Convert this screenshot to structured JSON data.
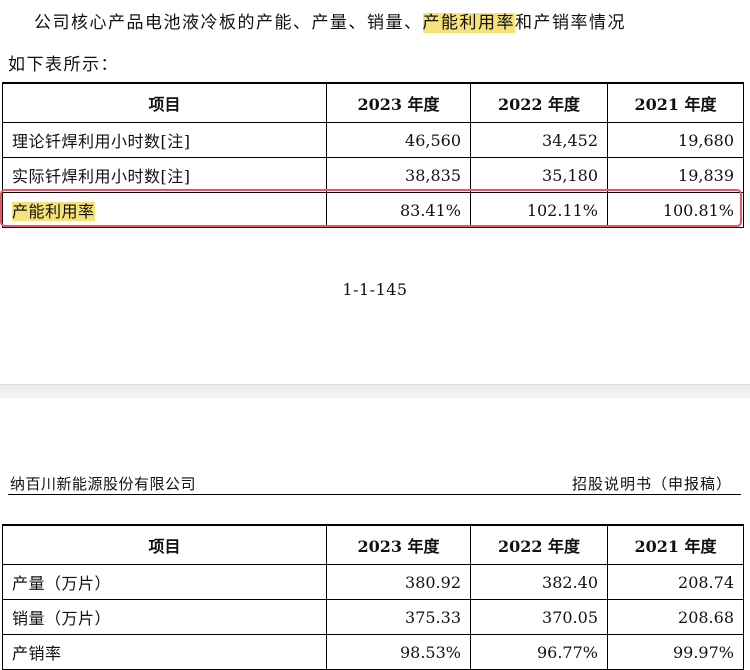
{
  "intro": {
    "line1_a": "公司核心产品电池液冷板的产能、产量、销量、",
    "line1_hl": "产能利用率",
    "line1_b": "和产销率情况",
    "line2": "如下表所示："
  },
  "capacity_table": {
    "headers": [
      "项目",
      "2023 年度",
      "2022 年度",
      "2021 年度"
    ],
    "rows": [
      {
        "label": "理论钎焊利用小时数[注]",
        "values": [
          "46,560",
          "34,452",
          "19,680"
        ]
      },
      {
        "label": "实际钎焊利用小时数[注]",
        "values": [
          "38,835",
          "35,180",
          "19,839"
        ]
      },
      {
        "label": "产能利用率",
        "values": [
          "83.41%",
          "102.11%",
          "100.81%"
        ]
      }
    ]
  },
  "page_number": "1-1-145",
  "running_header": {
    "company": "纳百川新能源股份有限公司",
    "doc_type": "招股说明书（申报稿）"
  },
  "production_table": {
    "headers": [
      "项目",
      "2023 年度",
      "2022 年度",
      "2021 年度"
    ],
    "rows": [
      {
        "label": "产量（万片）",
        "values": [
          "380.92",
          "382.40",
          "208.74"
        ]
      },
      {
        "label": "销量（万片）",
        "values": [
          "375.33",
          "370.05",
          "208.68"
        ]
      },
      {
        "label": "产销率",
        "values": [
          "98.53%",
          "96.77%",
          "99.97%"
        ]
      }
    ]
  },
  "colors": {
    "highlight": "#f5e27a",
    "callout_border": "#e8546a"
  }
}
